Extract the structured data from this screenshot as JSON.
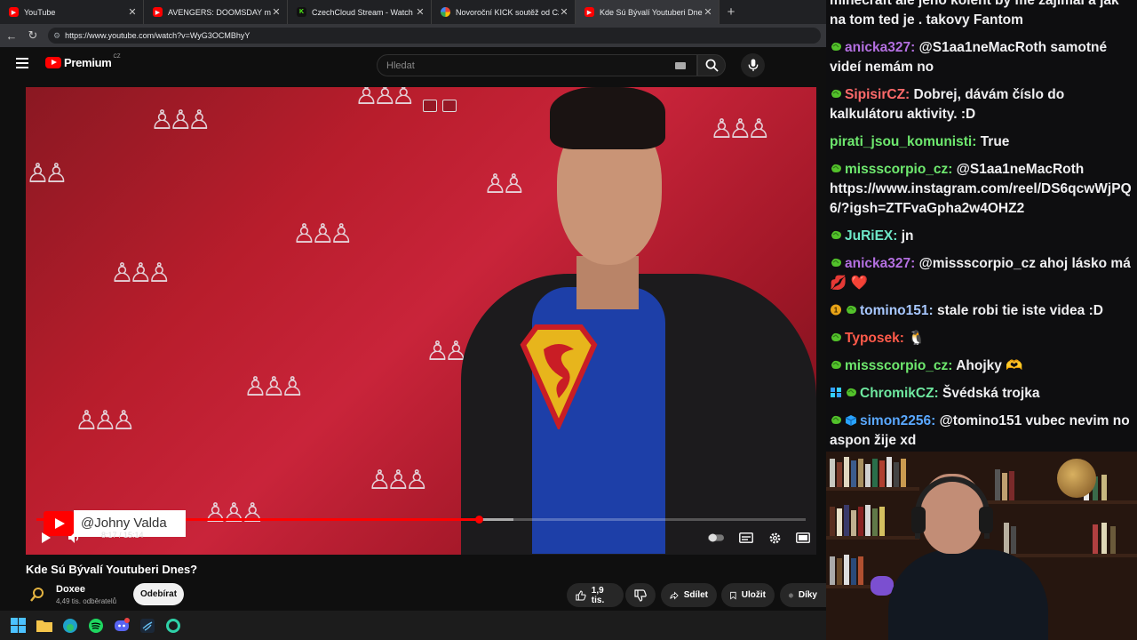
{
  "browser": {
    "tabs": [
      {
        "label": "YouTube",
        "favicon_color": "#ff0000",
        "active": false
      },
      {
        "label": "AVENGERS: DOOMSDAY mě začín",
        "favicon_color": "#ff0000",
        "active": false
      },
      {
        "label": "CzechCloud Stream - Watch Live o",
        "favicon_color": "#53fc18",
        "active": false
      },
      {
        "label": "Novoroční KICK soutěž od CzechC",
        "favicon_color": "#f4b400",
        "active": false
      },
      {
        "label": "Kde Sú Bývalí Youtuberi Dnes",
        "favicon_color": "#ff0000",
        "active": true
      }
    ],
    "url": "https://www.youtube.com/watch?v=WyG3OCMBhyY"
  },
  "youtube": {
    "logo_word": "Premium",
    "logo_country": "CZ",
    "search_placeholder": "Hledat",
    "player": {
      "watermark_handle": "@Johny Valda",
      "time_current": "8:17",
      "time_total": "15:14",
      "timecode": "8:17 / 15:14",
      "progress_fraction": 0.575,
      "buffered_fraction": 0.62
    },
    "video_title": "Kde Sú Bývalí Youtuberi Dnes?",
    "channel_name": "Doxee",
    "channel_subs": "4,49 tis. odběratelů",
    "subscribe_label": "Odebírat",
    "like_count": "1,9 tis.",
    "share_label": "Sdílet",
    "save_label": "Uložit",
    "thanks_label": "Díky"
  },
  "chat": {
    "messages": [
      {
        "user": "",
        "color": "#efeff1",
        "text": "minecraft ale jeho kolent by mě zajímal a jak na tom ted je . takovy Fantom",
        "badges": []
      },
      {
        "user": "anicka327:",
        "color": "#b36fe0",
        "text": "@S1aa1neMacRoth samotné videí nemám no",
        "badges": [
          "kick"
        ]
      },
      {
        "user": "SipisirCZ:",
        "color": "#ff6a6a",
        "text": "Dobrej, dávám číslo do kalkulátoru aktivity. :D",
        "badges": [
          "kick"
        ]
      },
      {
        "user": "pirati_jsou_komunisti:",
        "color": "#6ee86e",
        "text": "True",
        "badges": []
      },
      {
        "user": "missscorpio_cz:",
        "color": "#6ee86e",
        "text": "@S1aa1neMacRoth https://www.instagram.com/reel/DS6qcwWjPQ6/?igsh=ZTFvaGpha2w4OHZ2",
        "badges": [
          "kick"
        ]
      },
      {
        "user": "JuRiEX:",
        "color": "#6ee8c8",
        "text": "jn",
        "badges": [
          "kick"
        ]
      },
      {
        "user": "anicka327:",
        "color": "#b36fe0",
        "text": "@missscorpio_cz ahoj lásko má 💋 ❤️",
        "badges": [
          "kick"
        ]
      },
      {
        "user": "tomino151:",
        "color": "#a8c8ff",
        "text": "stale robi tie iste videa :D",
        "badges": [
          "gift",
          "kick"
        ]
      },
      {
        "user": "Typosek:",
        "color": "#ff5a4a",
        "text": "🐧",
        "badges": [
          "kick"
        ]
      },
      {
        "user": "missscorpio_cz:",
        "color": "#6ee86e",
        "text": "Ahojky 🫶",
        "badges": [
          "kick"
        ]
      },
      {
        "user": "ChromikCZ:",
        "color": "#6ee8a0",
        "text": "Švédská trojka",
        "badges": [
          "grid",
          "kick"
        ]
      },
      {
        "user": "simon2256:",
        "color": "#5aa8ff",
        "text": "@tomino151 vubec nevim no aspon žije xd",
        "badges": [
          "kick",
          "cube"
        ]
      }
    ]
  }
}
